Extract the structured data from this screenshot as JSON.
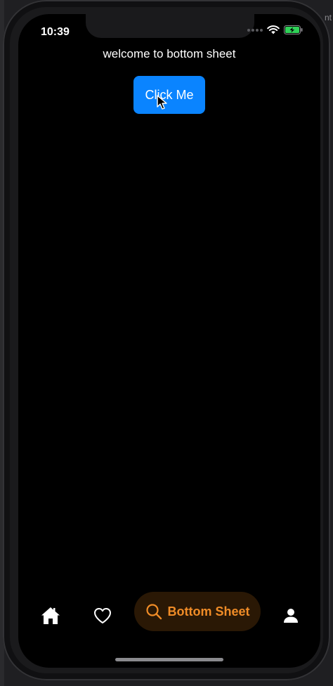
{
  "status_bar": {
    "time": "10:39"
  },
  "main": {
    "welcome_text": "welcome to bottom sheet",
    "click_button_label": "Click Me"
  },
  "bottom_nav": {
    "items": [
      {
        "icon": "home-icon"
      },
      {
        "icon": "heart-icon"
      },
      {
        "icon": "search-icon",
        "label": "Bottom Sheet",
        "active": true
      },
      {
        "icon": "person-icon"
      }
    ]
  },
  "colors": {
    "accent_blue": "#0a84ff",
    "active_orange": "#f08c27",
    "active_pill_bg": "#2a1805",
    "battery_green": "#30d158"
  },
  "desktop_edge_text": "nt"
}
